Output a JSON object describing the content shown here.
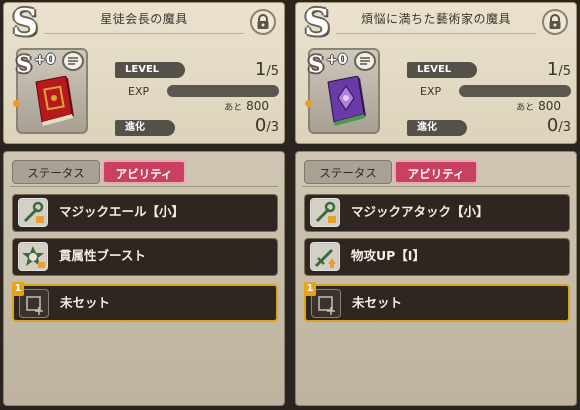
{
  "colors": {
    "accent": "#c94060",
    "selected_border": "#d9a520",
    "slot_bg": "#2f2622"
  },
  "panels": [
    {
      "rank": "S",
      "title": "星徒会長の魔具",
      "item_rank": "S",
      "plus_value": "+0",
      "book_color": "red",
      "level_label": "LEVEL",
      "level_value": "1",
      "level_max": "/5",
      "exp_label": "EXP",
      "ato_label": "あと",
      "ato_value": "800",
      "evolution_label": "進化",
      "evolution_value": "0",
      "evolution_max": "/3",
      "tabs": {
        "status": "ステータス",
        "ability": "アビリティ"
      },
      "slots": [
        {
          "name": "マジックエール【小】",
          "icon": "wrench-staff-icon"
        },
        {
          "name": "貫属性ブースト",
          "icon": "attribute-burst-icon"
        },
        {
          "name": "未セット",
          "icon": "empty-slot-icon",
          "number": "1"
        }
      ]
    },
    {
      "rank": "S",
      "title": "煩悩に満ちた藝術家の魔具",
      "item_rank": "S",
      "plus_value": "+0",
      "book_color": "purple",
      "level_label": "LEVEL",
      "level_value": "1",
      "level_max": "/5",
      "exp_label": "EXP",
      "ato_label": "あと",
      "ato_value": "800",
      "evolution_label": "進化",
      "evolution_value": "0",
      "evolution_max": "/3",
      "tabs": {
        "status": "ステータス",
        "ability": "アビリティ"
      },
      "slots": [
        {
          "name": "マジックアタック【小】",
          "icon": "wrench-staff-icon"
        },
        {
          "name": "物攻UP【Ⅰ】",
          "icon": "sword-up-icon"
        },
        {
          "name": "未セット",
          "icon": "empty-slot-icon",
          "number": "1"
        }
      ]
    }
  ]
}
